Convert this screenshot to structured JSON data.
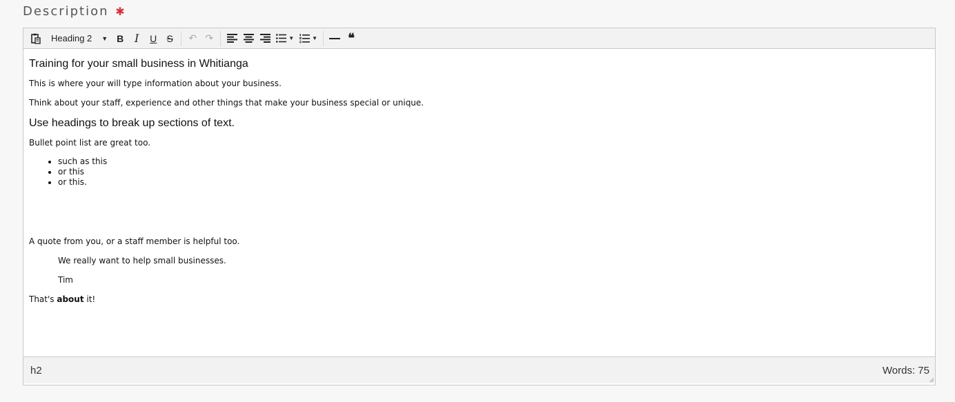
{
  "field": {
    "label": "Description",
    "required_mark": "✱"
  },
  "toolbar": {
    "format_select": "Heading 2",
    "bold": "B",
    "italic": "I",
    "underline": "U",
    "strike": "S",
    "undo": "↶",
    "redo": "↷",
    "quote": "❝",
    "icons": [
      "paste-icon",
      "format-caret-icon",
      "bold-icon",
      "italic-icon",
      "underline-icon",
      "strikethrough-icon",
      "undo-icon",
      "redo-icon",
      "align-left-icon",
      "align-center-icon",
      "align-right-icon",
      "bullet-list-icon",
      "numbered-list-icon",
      "horizontal-rule-icon",
      "blockquote-icon"
    ]
  },
  "content": {
    "heading1": "Training for your small business in Whitianga",
    "para1": "This is where your will type information about your business.",
    "para2": "Think about your staff, experience and other things that make your business special or unique.",
    "heading2": "Use headings to break up sections of text.",
    "para3": "Bullet point list are great too.",
    "bullets": [
      "such as this",
      "or this",
      "or this."
    ],
    "para4": "A quote from you, or a staff member is helpful too.",
    "quote_line1": "We really want to help small businesses.",
    "quote_line2": "Tim",
    "final_pre": "That's ",
    "final_bold": "about",
    "final_post": " it!"
  },
  "status": {
    "path": "h2",
    "word_count": "Words: 75"
  },
  "colors": {
    "required": "#d9303a",
    "toolbar_bg": "#f2f2f2",
    "border": "#c9c9c9"
  }
}
